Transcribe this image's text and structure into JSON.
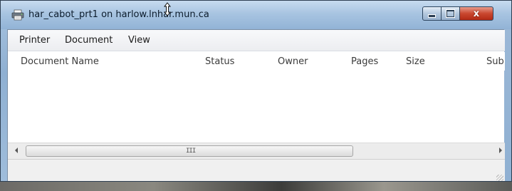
{
  "window": {
    "title": "har_cabot_prt1 on harlow.lnhar.mun.ca",
    "icon": "printer-icon",
    "controls": {
      "minimize": "minimize",
      "maximize": "maximize",
      "close": "x"
    }
  },
  "menu": {
    "items": [
      "Printer",
      "Document",
      "View"
    ]
  },
  "queue": {
    "columns": [
      "Document Name",
      "Status",
      "Owner",
      "Pages",
      "Size",
      "Sub"
    ],
    "rows": []
  },
  "scrollbar": {
    "grip": "III"
  },
  "status": {
    "text": ""
  },
  "colors": {
    "titlebar": "#a8c4e1",
    "close_button": "#c9472f",
    "client_bg": "#ffffff"
  }
}
